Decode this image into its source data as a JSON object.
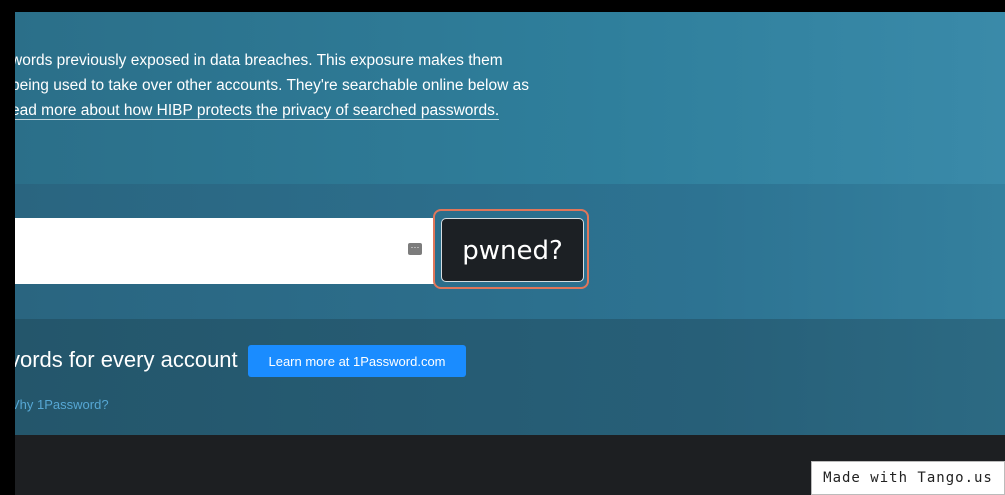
{
  "intro": {
    "lines": [
      "words previously exposed in data breaches. This exposure makes them",
      "being used to take over other accounts. They're searchable online below as"
    ],
    "link_text": "ead more about how HIBP protects the privacy of searched passwords."
  },
  "search": {
    "value": "",
    "placeholder": "",
    "manager_icon": "password-manager-icon",
    "submit_label": "pwned?"
  },
  "promo": {
    "heading": "vords for every account",
    "button_label": "Learn more at 1Password.com",
    "why_link": "Vhy 1Password?"
  },
  "watermark": {
    "text": "Made with Tango.us"
  },
  "colors": {
    "highlight": "#e0765a",
    "primary_button": "#1a8cff",
    "submit_button": "#1c2024"
  }
}
